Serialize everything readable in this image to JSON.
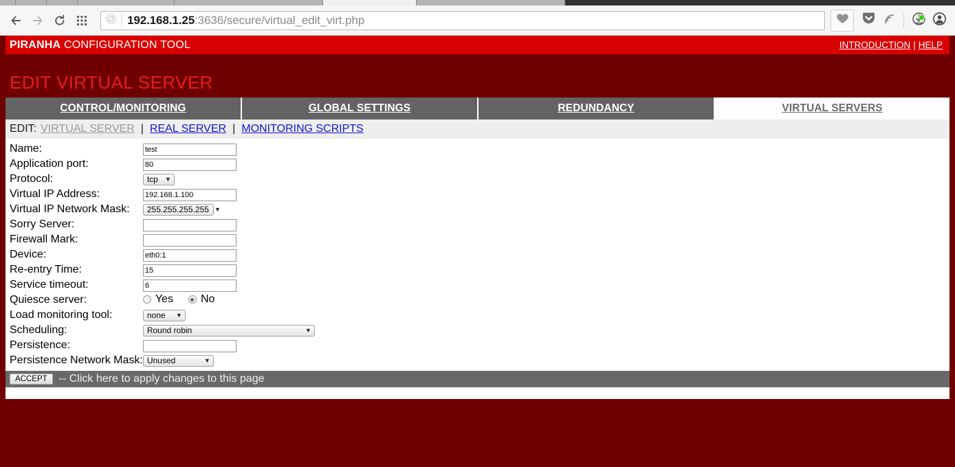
{
  "browser": {
    "nav": {
      "back_icon": "arrow-left-icon",
      "forward_icon": "arrow-right-icon",
      "reload_icon": "reload-icon",
      "apps_icon": "grid-apps-icon"
    },
    "url": {
      "identity_icon": "globe-icon",
      "host": "192.168.1.25",
      "rest": ":3636/secure/virtual_edit_virt.php",
      "full": "192.168.1.25:3636/secure/virtual_edit_virt.php"
    },
    "toolbar_icons": [
      "heart-bookmark-icon",
      "pocket-icon",
      "rss-feed-icon",
      "download-icon",
      "account-icon"
    ]
  },
  "brand": {
    "name_bold": "PIRANHA",
    "name_rest": "CONFIGURATION TOOL",
    "links": {
      "introduction": "INTRODUCTION",
      "separator": "|",
      "help": "HELP"
    },
    "bar_color": "#d90000",
    "page_bg": "#6e0000"
  },
  "heading": "EDIT VIRTUAL SERVER",
  "tabs": [
    {
      "label": "CONTROL/MONITORING",
      "active": false
    },
    {
      "label": "GLOBAL SETTINGS",
      "active": false
    },
    {
      "label": "REDUNDANCY",
      "active": false
    },
    {
      "label": "VIRTUAL SERVERS",
      "active": true
    }
  ],
  "subnav": {
    "lead": "EDIT:",
    "current": "VIRTUAL SERVER",
    "sep": "|",
    "links": [
      "REAL SERVER",
      "MONITORING SCRIPTS"
    ]
  },
  "form": {
    "labels": {
      "name": "Name:",
      "app_port": "Application port:",
      "protocol": "Protocol:",
      "virtual_ip": "Virtual IP Address:",
      "virtual_mask": "Virtual IP Network Mask:",
      "sorry_server": "Sorry Server:",
      "firewall_mark": "Firewall Mark:",
      "device": "Device:",
      "reentry": "Re-entry Time:",
      "timeout": "Service timeout:",
      "quiesce": "Quiesce server:",
      "load_tool": "Load monitoring tool:",
      "scheduling": "Scheduling:",
      "persistence": "Persistence:",
      "persistence_mask": "Persistence Network Mask:"
    },
    "values": {
      "name": "test",
      "app_port": "80",
      "protocol": "tcp",
      "virtual_ip": "192.168.1.100",
      "virtual_mask": "255.255.255.255",
      "sorry_server": "",
      "firewall_mark": "",
      "device": "eth0:1",
      "reentry": "15",
      "timeout": "6",
      "quiesce_yes": "Yes",
      "quiesce_no": "No",
      "quiesce_selected": "No",
      "load_tool": "none",
      "scheduling": "Round robin",
      "persistence": "",
      "persistence_mask": "Unused"
    }
  },
  "accept": {
    "button_label": "ACCEPT",
    "note": "-- Click here to apply changes to this page"
  }
}
